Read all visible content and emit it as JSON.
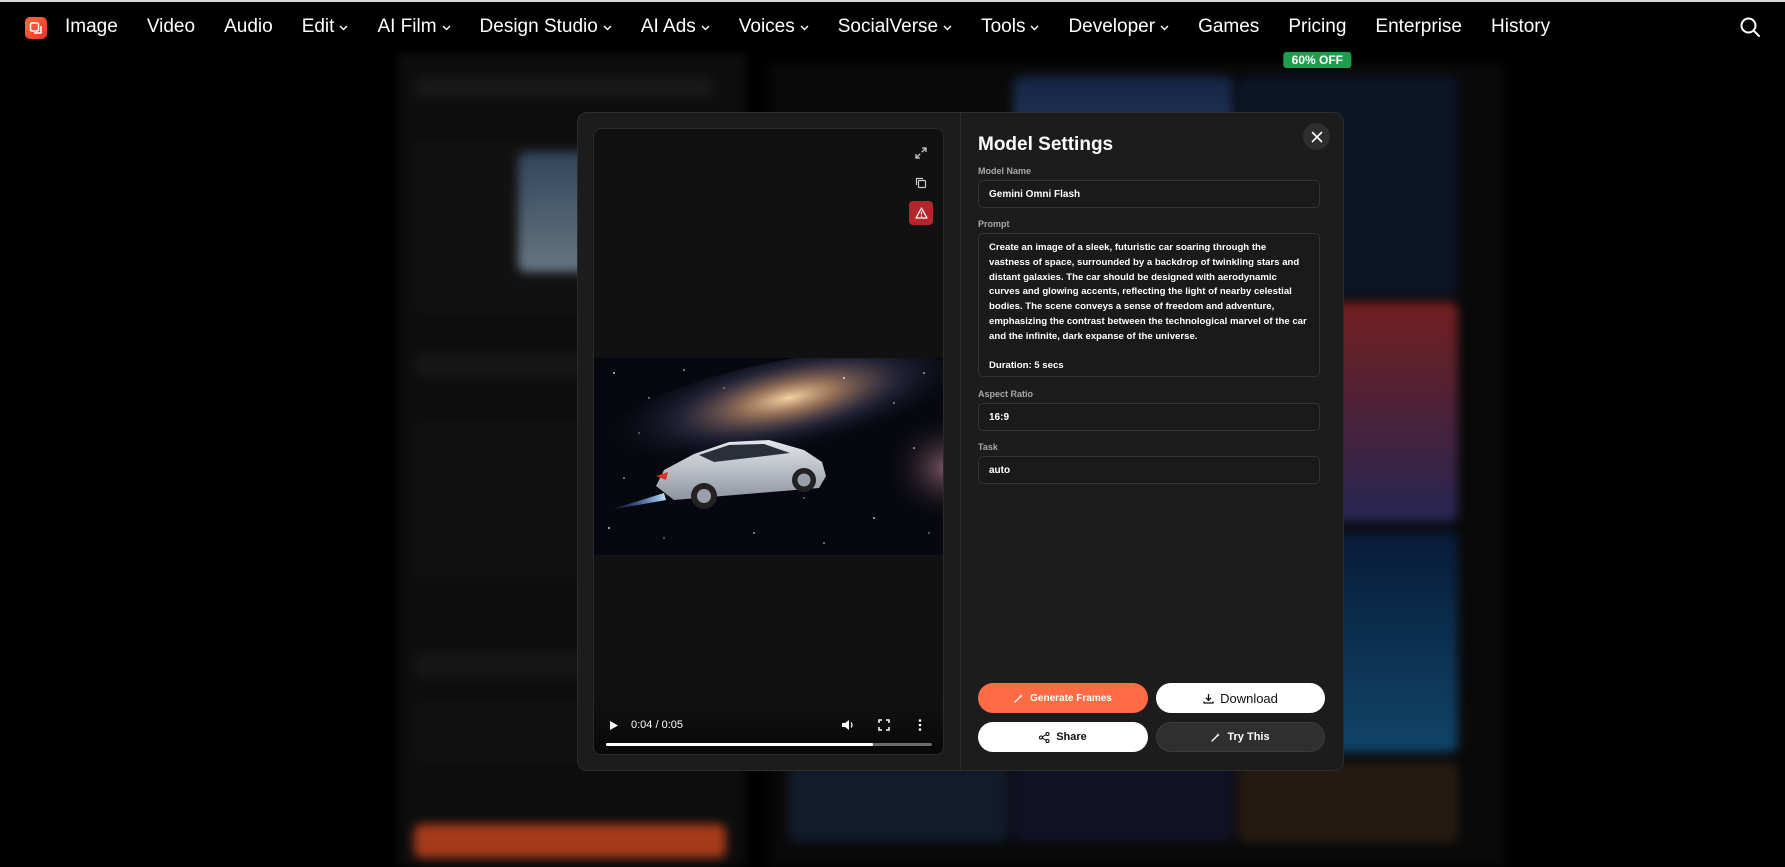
{
  "nav": {
    "items": [
      {
        "label": "Image",
        "dropdown": false
      },
      {
        "label": "Video",
        "dropdown": false
      },
      {
        "label": "Audio",
        "dropdown": false
      },
      {
        "label": "Edit",
        "dropdown": true
      },
      {
        "label": "AI Film",
        "dropdown": true
      },
      {
        "label": "Design Studio",
        "dropdown": true
      },
      {
        "label": "AI Ads",
        "dropdown": true
      },
      {
        "label": "Voices",
        "dropdown": true
      },
      {
        "label": "SocialVerse",
        "dropdown": true
      },
      {
        "label": "Tools",
        "dropdown": true
      },
      {
        "label": "Developer",
        "dropdown": true
      },
      {
        "label": "Games",
        "dropdown": false
      },
      {
        "label": "Pricing",
        "dropdown": false,
        "badge": "60% OFF"
      },
      {
        "label": "Enterprise",
        "dropdown": false
      },
      {
        "label": "History",
        "dropdown": false
      }
    ],
    "badge_color": "#1f9d4d",
    "search_icon": "search-icon"
  },
  "player": {
    "time": "0:04 / 0:05",
    "progress": 0.82,
    "icons": [
      "expand-icon",
      "copy-icon",
      "report-icon",
      "play-icon",
      "volume-icon",
      "fullscreen-icon",
      "more-icon"
    ]
  },
  "settings": {
    "title": "Model Settings",
    "model_label": "Model Name",
    "model_value": "Gemini Omni Flash",
    "prompt_label": "Prompt",
    "prompt_value": "Create an image of a sleek, futuristic car soaring through the vastness of space, surrounded by a backdrop of twinkling stars and distant galaxies. The car should be designed with aerodynamic curves and glowing accents, reflecting the light of nearby celestial bodies. The scene conveys a sense of freedom and adventure, emphasizing the contrast between the technological marvel of the car and the infinite, dark expanse of the universe.\n\nDuration: 5 secs",
    "aspect_label": "Aspect Ratio",
    "aspect_value": "16:9",
    "task_label": "Task",
    "task_value": "auto"
  },
  "buttons": {
    "generate": "Generate Frames",
    "download": "Download",
    "share": "Share",
    "try": "Try This"
  },
  "colors": {
    "accent": "#ff6b45",
    "report": "#b3262c"
  }
}
